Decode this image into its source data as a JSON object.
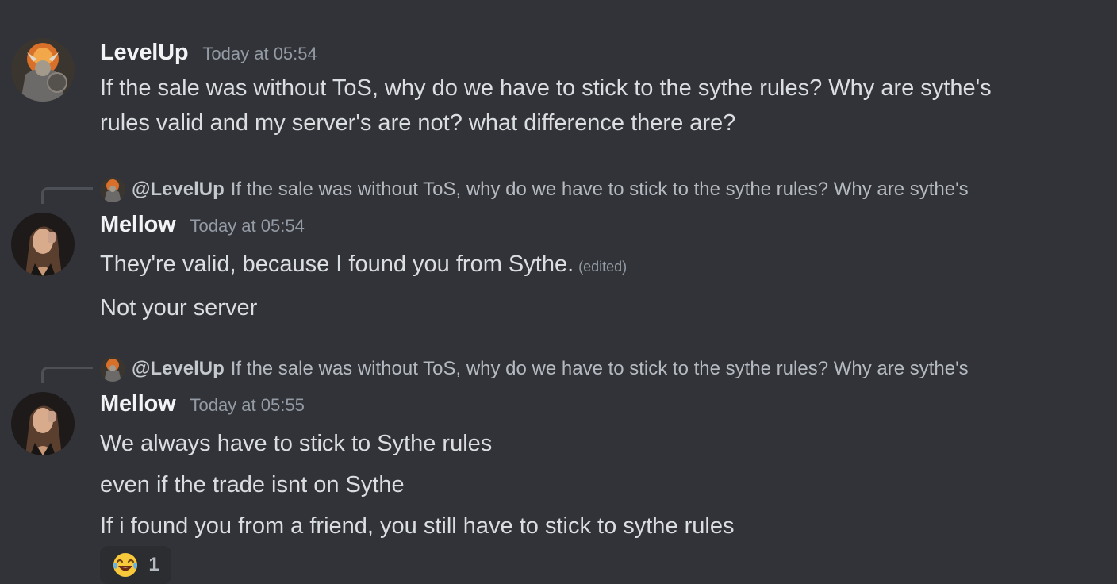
{
  "messages": [
    {
      "author": "LevelUp",
      "timestamp": "Today at 05:54",
      "lines": [
        "If the sale was without ToS, why do we have to stick to the sythe rules? Why are sythe's",
        "rules valid and my server's are not? what difference there are?"
      ]
    },
    {
      "reply": {
        "mention": "@LevelUp",
        "text": "If the sale was without ToS, why do we have to stick to the sythe rules? Why are sythe's"
      },
      "author": "Mellow",
      "timestamp": "Today at 05:54",
      "lines": [
        "They're valid, because I found you from Sythe.",
        "Not your server"
      ],
      "edited_label": "(edited)"
    },
    {
      "reply": {
        "mention": "@LevelUp",
        "text": "If the sale was without ToS, why do we have to stick to the sythe rules? Why are sythe's"
      },
      "author": "Mellow",
      "timestamp": "Today at 05:55",
      "lines": [
        "We always have to stick to Sythe rules",
        "even if the trade isnt on Sythe",
        "If i found you from a friend, you still have to stick to sythe rules"
      ],
      "reaction": {
        "emoji": "face-with-tears-of-joy",
        "count": "1"
      }
    }
  ],
  "colors": {
    "background": "#313338",
    "username": "#f2f3f5",
    "text": "#dbdee1",
    "muted": "#949ba4"
  }
}
